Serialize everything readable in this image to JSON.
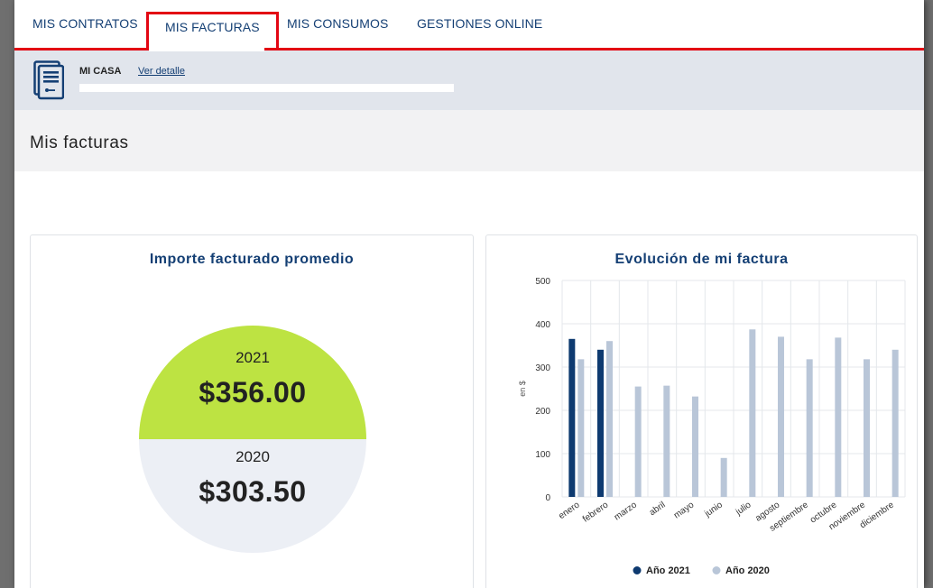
{
  "nav": {
    "tabs": [
      {
        "label": "MIS CONTRATOS",
        "active": false
      },
      {
        "label": "MIS FACTURAS",
        "active": true
      },
      {
        "label": "MIS CONSUMOS",
        "active": false
      },
      {
        "label": "GESTIONES ONLINE",
        "active": false
      }
    ],
    "accent_color": "#e30613"
  },
  "contract": {
    "icon": "document-icon",
    "name": "MI CASA",
    "detail_link": "Ver detalle"
  },
  "page": {
    "title": "Mis facturas"
  },
  "average_card": {
    "title": "Importe facturado promedio",
    "current": {
      "year": "2021",
      "amount": "$356.00",
      "color": "#bde342"
    },
    "previous": {
      "year": "2020",
      "amount": "$303.50",
      "color": "#eceff5"
    }
  },
  "evolution_card": {
    "title": "Evolución de mi factura"
  },
  "chart_data": {
    "type": "bar",
    "title": "Evolución de mi factura",
    "ylabel": "en $",
    "xlabel": "",
    "ylim": [
      0,
      500
    ],
    "yticks": [
      0,
      100,
      200,
      300,
      400,
      500
    ],
    "grid": true,
    "legend_position": "bottom",
    "categories": [
      "enero",
      "febrero",
      "marzo",
      "abril",
      "mayo",
      "junio",
      "julio",
      "agosto",
      "septiembre",
      "octubre",
      "noviembre",
      "diciembre"
    ],
    "series": [
      {
        "name": "Año 2021",
        "color": "#0e3a70",
        "values": [
          365,
          340,
          null,
          null,
          null,
          null,
          null,
          null,
          null,
          null,
          null,
          null
        ]
      },
      {
        "name": "Año 2020",
        "color": "#b9c6d8",
        "values": [
          318,
          360,
          255,
          257,
          232,
          90,
          387,
          370,
          318,
          368,
          318,
          340
        ]
      }
    ]
  }
}
